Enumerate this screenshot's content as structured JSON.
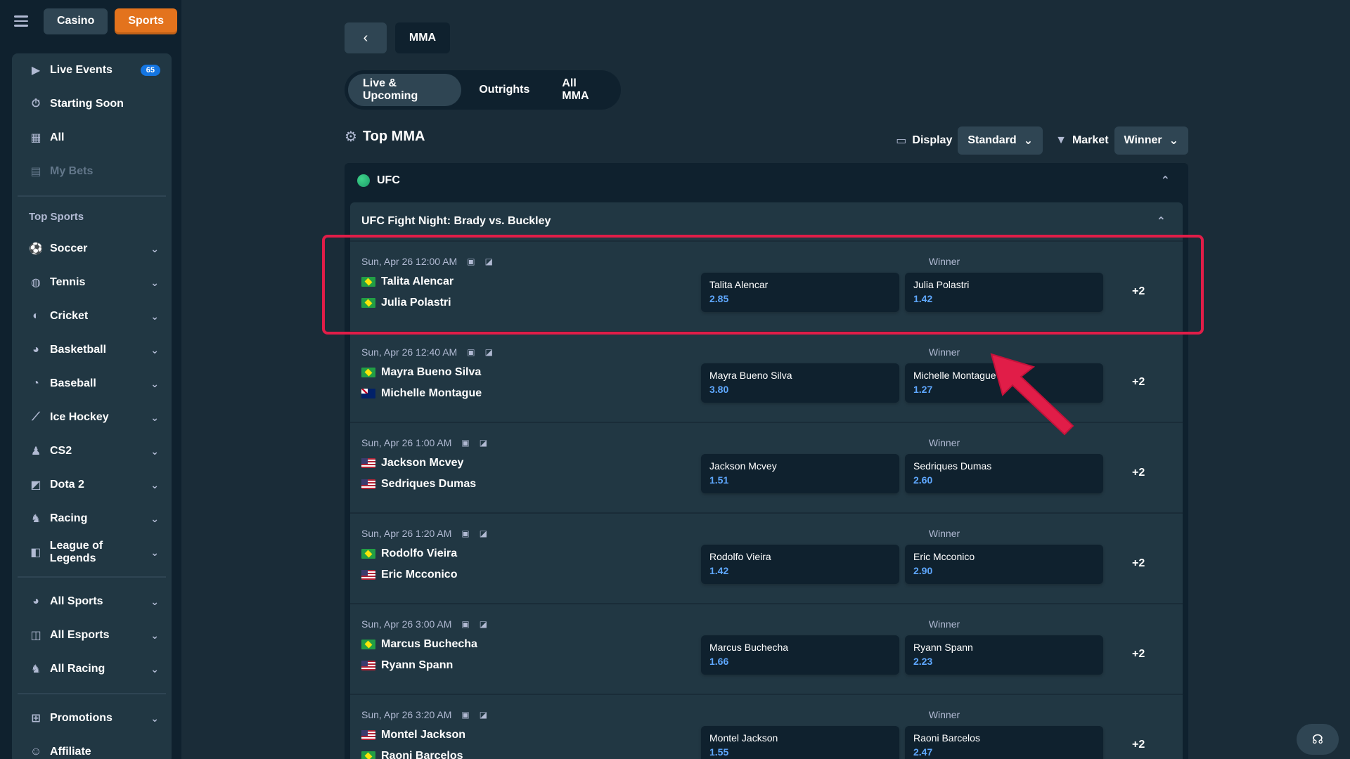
{
  "topbar": {
    "casino_label": "Casino",
    "sports_label": "Sports"
  },
  "sidebar": {
    "main_items": [
      {
        "label": "Live Events",
        "icon": "play-circle-icon",
        "badge": "65"
      },
      {
        "label": "Starting Soon",
        "icon": "stopwatch-icon"
      },
      {
        "label": "All",
        "icon": "grid-icon"
      },
      {
        "label": "My Bets",
        "icon": "receipt-icon"
      }
    ],
    "top_sports_title": "Top Sports",
    "sports": [
      {
        "label": "Soccer",
        "icon": "soccer-ball-icon"
      },
      {
        "label": "Tennis",
        "icon": "tennis-ball-icon"
      },
      {
        "label": "Cricket",
        "icon": "cricket-ball-icon"
      },
      {
        "label": "Basketball",
        "icon": "basketball-icon"
      },
      {
        "label": "Baseball",
        "icon": "baseball-icon"
      },
      {
        "label": "Ice Hockey",
        "icon": "hockey-stick-icon"
      },
      {
        "label": "CS2",
        "icon": "soldier-icon"
      },
      {
        "label": "Dota 2",
        "icon": "dota-icon"
      },
      {
        "label": "Racing",
        "icon": "horse-icon"
      },
      {
        "label": "League of Legends",
        "icon": "lol-icon"
      }
    ],
    "all_items": [
      {
        "label": "All Sports",
        "icon": "sports-icon"
      },
      {
        "label": "All Esports",
        "icon": "gamepad-icon"
      },
      {
        "label": "All Racing",
        "icon": "horse-icon"
      }
    ],
    "bottom_items": [
      {
        "label": "Promotions",
        "icon": "gift-icon"
      },
      {
        "label": "Affiliate",
        "icon": "users-icon"
      }
    ]
  },
  "breadcrumb": {
    "current": "MMA"
  },
  "tabs": [
    "Live & Upcoming",
    "Outrights",
    "All MMA"
  ],
  "section": {
    "title": "Top MMA"
  },
  "controls": {
    "display_label": "Display",
    "display_value": "Standard",
    "market_label": "Market",
    "market_value": "Winner"
  },
  "league": {
    "name": "UFC"
  },
  "event": {
    "name": "UFC Fight Night: Brady vs. Buckley"
  },
  "market_label": "Winner",
  "matches": [
    {
      "time": "Sun, Apr 26  12:00 AM",
      "team1": "Talita Alencar",
      "flag1": "br",
      "team2": "Julia Polastri",
      "flag2": "br",
      "odd1_name": "Talita Alencar",
      "odd1": "2.85",
      "odd2_name": "Julia Polastri",
      "odd2": "1.42",
      "more": "+2"
    },
    {
      "time": "Sun, Apr 26  12:40 AM",
      "team1": "Mayra Bueno Silva",
      "flag1": "br",
      "team2": "Michelle Montague",
      "flag2": "nz",
      "odd1_name": "Mayra Bueno Silva",
      "odd1": "3.80",
      "odd2_name": "Michelle Montague",
      "odd2": "1.27",
      "more": "+2"
    },
    {
      "time": "Sun, Apr 26  1:00 AM",
      "team1": "Jackson Mcvey",
      "flag1": "us",
      "team2": "Sedriques Dumas",
      "flag2": "us",
      "odd1_name": "Jackson Mcvey",
      "odd1": "1.51",
      "odd2_name": "Sedriques Dumas",
      "odd2": "2.60",
      "more": "+2"
    },
    {
      "time": "Sun, Apr 26  1:20 AM",
      "team1": "Rodolfo Vieira",
      "flag1": "br",
      "team2": "Eric Mcconico",
      "flag2": "us",
      "odd1_name": "Rodolfo Vieira",
      "odd1": "1.42",
      "odd2_name": "Eric Mcconico",
      "odd2": "2.90",
      "more": "+2"
    },
    {
      "time": "Sun, Apr 26  3:00 AM",
      "team1": "Marcus Buchecha",
      "flag1": "br",
      "team2": "Ryann Spann",
      "flag2": "us",
      "odd1_name": "Marcus Buchecha",
      "odd1": "1.66",
      "odd2_name": "Ryann Spann",
      "odd2": "2.23",
      "more": "+2"
    },
    {
      "time": "Sun, Apr 26  3:20 AM",
      "team1": "Montel Jackson",
      "flag1": "us",
      "team2": "Raoni Barcelos",
      "flag2": "br",
      "odd1_name": "Montel Jackson",
      "odd1": "1.55",
      "odd2_name": "Raoni Barcelos",
      "odd2": "2.47",
      "more": "+2"
    }
  ],
  "colors": {
    "accent": "#e3731d",
    "odds": "#5fa8ff",
    "highlight": "#e11d48",
    "badge": "#1475e1"
  }
}
